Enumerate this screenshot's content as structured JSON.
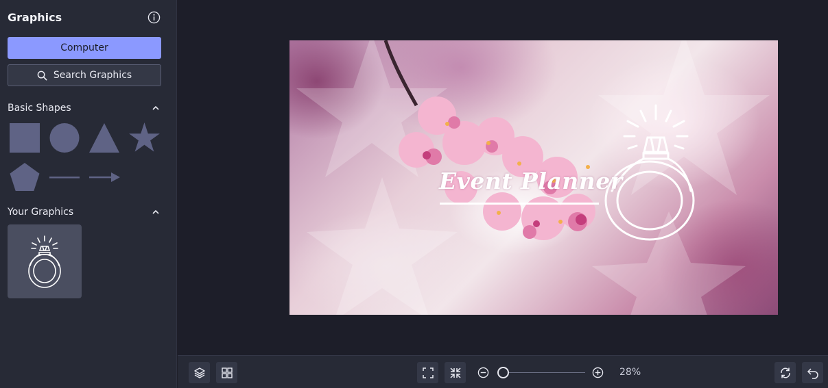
{
  "sidebar": {
    "title": "Graphics",
    "computer_button": "Computer",
    "search_button": "Search Graphics",
    "basic_shapes_title": "Basic Shapes",
    "basic_shapes": [
      "square",
      "circle",
      "triangle",
      "star",
      "pentagon",
      "line",
      "arrow"
    ],
    "your_graphics_title": "Your Graphics",
    "your_graphics": [
      "ring-graphic"
    ]
  },
  "canvas": {
    "text": "Event Planner"
  },
  "toolbar": {
    "zoom_label": "28%",
    "zoom_value": 0.28
  },
  "colors": {
    "accent": "#8b99ff",
    "shape_fill": "#5f6385",
    "panel_bg": "#272a36",
    "workspace_bg": "#1d1e29"
  }
}
